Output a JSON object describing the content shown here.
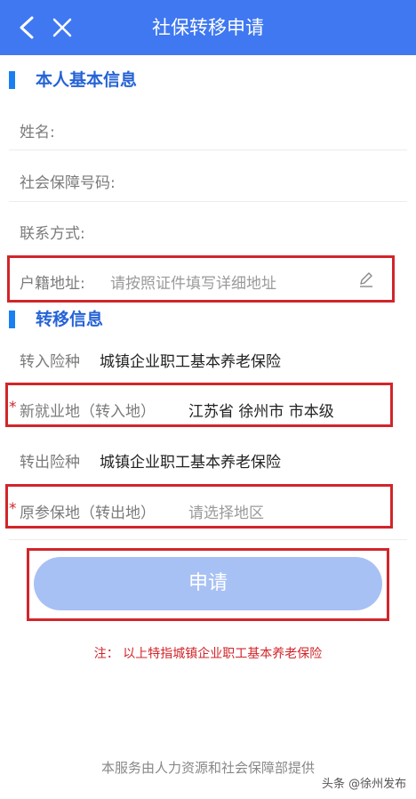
{
  "header": {
    "title": "社保转移申请"
  },
  "personal": {
    "section_title": "本人基本信息",
    "name_label": "姓名:",
    "ssn_label": "社会保障号码:",
    "contact_label": "联系方式:",
    "address_label": "户籍地址:",
    "address_placeholder": "请按照证件填写详细地址"
  },
  "transfer": {
    "section_title": "转移信息",
    "in_type_label": "转入险种",
    "in_type_value": "城镇企业职工基本养老保险",
    "required_mark": "*",
    "new_place_label": "新就业地（转入地）",
    "new_place_value": "江苏省 徐州市 市本级",
    "out_type_label": "转出险种",
    "out_type_value": "城镇企业职工基本养老保险",
    "old_place_label": "原参保地（转出地）",
    "old_place_placeholder": "请选择地区"
  },
  "apply_button": "申请",
  "note": "注：  以上特指城镇企业职工基本养老保险",
  "footer": "本服务由人力资源和社会保障部提供",
  "watermark": "头条 @徐州发布",
  "colors": {
    "header_bg": "#3f78f1",
    "accent": "#2563d6",
    "highlight": "#d2252a",
    "button": "#a8c1f4"
  }
}
